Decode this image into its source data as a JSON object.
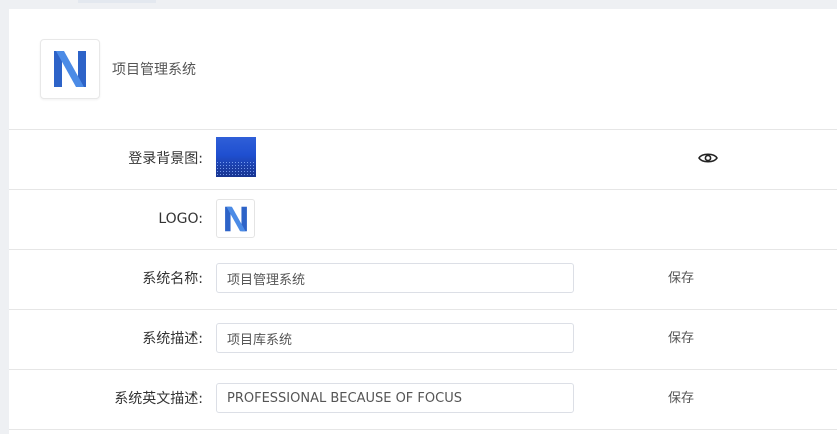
{
  "header": {
    "app_name": "项目管理系统",
    "logo_icon": "app-logo-icon"
  },
  "settings": {
    "background": {
      "label": "登录背景图:",
      "thumbnail": "login-background-thumbnail",
      "preview_icon": "eye-icon"
    },
    "logo": {
      "label": "LOGO:",
      "thumbnail": "logo-thumbnail"
    },
    "system_name": {
      "label": "系统名称:",
      "value": "项目管理系统",
      "save_label": "保存"
    },
    "system_desc": {
      "label": "系统描述:",
      "value": "项目库系统",
      "save_label": "保存"
    },
    "system_en_desc": {
      "label": "系统英文描述:",
      "value": "PROFESSIONAL BECAUSE OF FOCUS",
      "save_label": "保存"
    }
  },
  "colors": {
    "logo_primary": "#2d63c8",
    "logo_light": "#4b8be6",
    "page_bg": "#eef0f3",
    "border": "#e6e6e6"
  }
}
